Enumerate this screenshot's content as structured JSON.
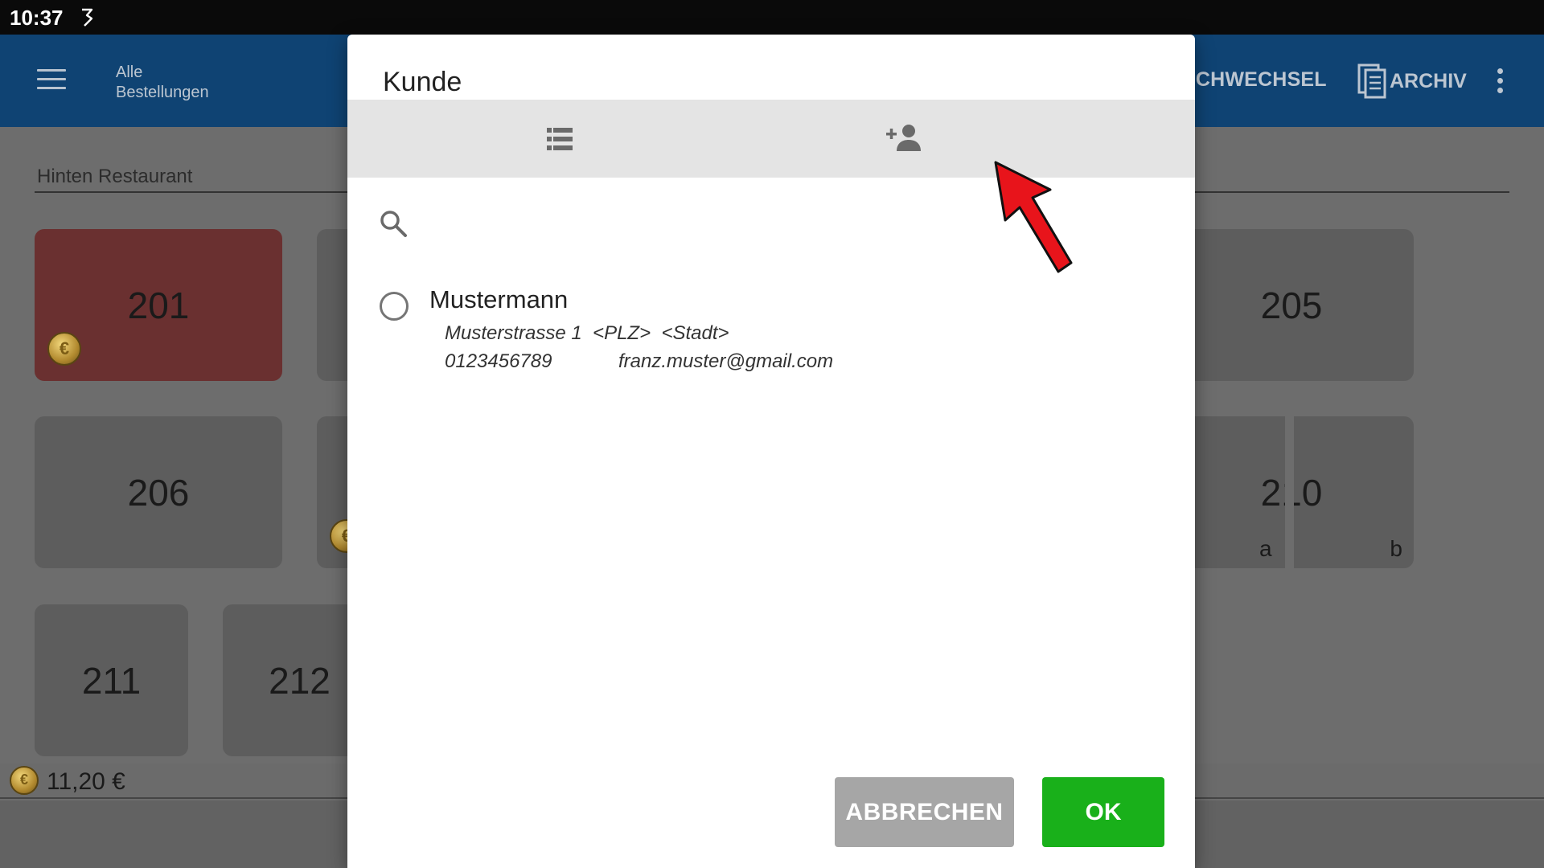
{
  "status_bar": {
    "time": "10:37"
  },
  "app_bar": {
    "title_line1": "Alle",
    "title_line2": "Bestellungen",
    "action_tischwechsel": "SCHWECHSEL",
    "action_archiv": "ARCHIV"
  },
  "room": {
    "label": "Hinten Restaurant"
  },
  "tables": {
    "t201": "201",
    "t205": "205",
    "t206": "206",
    "t210": "210",
    "t210a": "a",
    "t210b": "b",
    "t211": "211",
    "t212": "212"
  },
  "total": {
    "amount": "11,20 €"
  },
  "dialog": {
    "title": "Kunde",
    "search_placeholder": "",
    "customer": {
      "name": "Mustermann",
      "address": "Musterstrasse 1  <PLZ>  <Stadt>",
      "phone": "0123456789",
      "email": "franz.muster@gmail.com"
    },
    "cancel_label": "ABBRECHEN",
    "ok_label": "OK"
  },
  "colors": {
    "app_bar": "#0f4373",
    "ok_button": "#19b01a",
    "cancel_button": "#a6a6a6",
    "occupied_table": "#6a3030",
    "pointer_arrow": "#e8141b"
  },
  "icons": {
    "menu": "menu-icon",
    "archiv": "archive-icon",
    "overflow": "more-vert-icon",
    "list_tab": "list-icon",
    "add_customer_tab": "person-add-icon",
    "search": "search-icon",
    "coin": "euro-coin-icon"
  }
}
